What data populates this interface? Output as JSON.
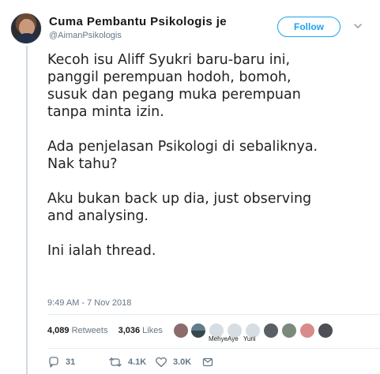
{
  "profile": {
    "display_name": "Cuma Pembantu Psikologis je",
    "username": "@AimanPsikologis",
    "avatar_icon": "profile-avatar-icon"
  },
  "header": {
    "follow_label": "Follow",
    "more_icon": "chevron-down-icon"
  },
  "tweet": {
    "paragraphs": {
      "p1": {
        "line1": "Kecoh isu Aliff Syukri baru-baru ini,",
        "line2": "panggil perempuan hodoh, bomoh,",
        "line3": "susuk dan pegang muka perempuan",
        "line4": "tanpa minta izin."
      },
      "p2": {
        "line1": "Ada penjelasan Psikologi di sebaliknya.",
        "line2": "Nak tahu?"
      },
      "p3": {
        "line1": "Aku bukan back up dia, just observing",
        "line2": "and analysing."
      },
      "p4": {
        "line1": "Ini ialah thread."
      }
    },
    "timestamp": "9:49 AM - 7 Nov 2018"
  },
  "stats": {
    "retweets_count": "4,089",
    "retweets_label": "Retweets",
    "likes_count": "3,036",
    "likes_label": "Likes"
  },
  "likers": {
    "labels": {
      "first": "Mehye",
      "second": "Aye",
      "third": "Yuni"
    }
  },
  "actions": {
    "reply": {
      "icon": "reply-icon",
      "count": "31"
    },
    "retweet": {
      "icon": "retweet-icon",
      "count": "4.1K"
    },
    "like": {
      "icon": "heart-icon",
      "count": "3.0K"
    },
    "message": {
      "icon": "message-icon"
    }
  },
  "colors": {
    "accent": "#1da1f2",
    "text": "#14171a",
    "muted": "#657786",
    "line": "#cfd9de"
  }
}
